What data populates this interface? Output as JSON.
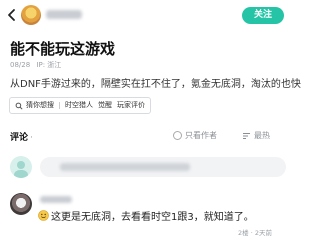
{
  "header": {
    "follow_label": "关注"
  },
  "post": {
    "title": "能不能玩这游戏",
    "date": "08/28",
    "location": "IP: 浙江",
    "body": "从DNF手游过来的，隔壁实在扛不住了，氪金无底洞，淘汰的也快",
    "tags": [
      "猜你想搜",
      "时空猎人",
      "觉醒",
      "玩家评价"
    ]
  },
  "comments": {
    "title": "评论",
    "only_author": "只看作者",
    "sort_label": "最热",
    "items": [
      {
        "text": "这更是无底洞，去看看时空1跟3，就知道了。",
        "meta": "2楼 · 2天前"
      }
    ]
  },
  "colors": {
    "accent": "#25c4a6"
  },
  "icons": {
    "back": "chevron-left-icon",
    "search_tag": "search-icon",
    "sort": "sort-icon",
    "emoji": "smile-emoji-icon"
  }
}
